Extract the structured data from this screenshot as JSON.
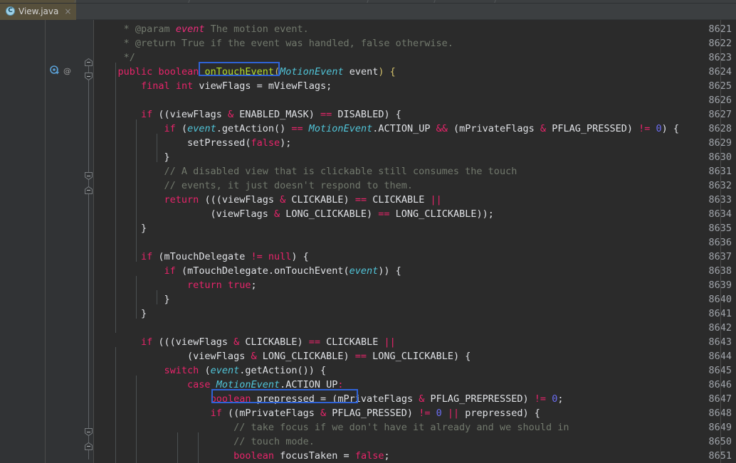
{
  "window": {
    "app": "java-code-editor",
    "theme_bg": "#2b2b2b",
    "gutter_bg": "#313335",
    "accent_highlight": "#2f63d7",
    "tab_bg": "#57503c"
  },
  "tabbar": {
    "tabs": [
      {
        "label": "View.java",
        "icon": "java-class-icon",
        "icon_letter": "C",
        "close": "×",
        "active": true
      }
    ]
  },
  "editor": {
    "first_line": 8621,
    "gutter_icons": {
      "line": 8624,
      "override_icon": "overriding-method-icon",
      "annotation_icon": "annotation-at-icon",
      "annotation_glyph": "@"
    },
    "highlights": [
      {
        "line": 8624,
        "text": "onTouchEvent",
        "color": "#2f63d7"
      },
      {
        "line": 8646,
        "text": "MotionEvent.ACTION_UP:",
        "color": "#2f63d7"
      }
    ],
    "lines": [
      {
        "n": 8621,
        "tokens": [
          {
            "t": "     * ",
            "c": "doc"
          },
          {
            "t": "@param ",
            "c": "doc"
          },
          {
            "t": "event",
            "c": "param"
          },
          {
            "t": " The motion event.",
            "c": "doc"
          }
        ]
      },
      {
        "n": 8622,
        "tokens": [
          {
            "t": "     * ",
            "c": "doc"
          },
          {
            "t": "@return True if the event was handled, false otherwise.",
            "c": "doc"
          }
        ]
      },
      {
        "n": 8623,
        "tokens": [
          {
            "t": "     */",
            "c": "doc"
          }
        ]
      },
      {
        "n": 8624,
        "tokens": [
          {
            "t": "    ",
            "c": "plain"
          },
          {
            "t": "public",
            "c": "kw2"
          },
          {
            "t": " ",
            "c": "plain"
          },
          {
            "t": "boolean",
            "c": "kw2"
          },
          {
            "t": " ",
            "c": "plain"
          },
          {
            "t": "onTouchEvent",
            "c": "mth"
          },
          {
            "t": "(",
            "c": "brcy"
          },
          {
            "t": "MotionEvent",
            "c": "typ"
          },
          {
            "t": " event",
            "c": "plain"
          },
          {
            "t": ")",
            "c": "brcy"
          },
          {
            "t": " ",
            "c": "plain"
          },
          {
            "t": "{",
            "c": "brcy"
          }
        ]
      },
      {
        "n": 8625,
        "tokens": [
          {
            "t": "        ",
            "c": "plain"
          },
          {
            "t": "final",
            "c": "kw2"
          },
          {
            "t": " ",
            "c": "plain"
          },
          {
            "t": "int",
            "c": "kw2"
          },
          {
            "t": " viewFlags ",
            "c": "plain"
          },
          {
            "t": "=",
            "c": "plain"
          },
          {
            "t": " mViewFlags;",
            "c": "plain"
          }
        ]
      },
      {
        "n": 8626,
        "tokens": []
      },
      {
        "n": 8627,
        "tokens": [
          {
            "t": "        ",
            "c": "plain"
          },
          {
            "t": "if",
            "c": "kw2"
          },
          {
            "t": " ((viewFlags ",
            "c": "plain"
          },
          {
            "t": "&",
            "c": "op"
          },
          {
            "t": " ENABLED_MASK) ",
            "c": "plain"
          },
          {
            "t": "==",
            "c": "op"
          },
          {
            "t": " DISABLED) {",
            "c": "plain"
          }
        ]
      },
      {
        "n": 8628,
        "tokens": [
          {
            "t": "            ",
            "c": "plain"
          },
          {
            "t": "if",
            "c": "kw2"
          },
          {
            "t": " (",
            "c": "plain"
          },
          {
            "t": "event",
            "c": "fld"
          },
          {
            "t": ".getAction() ",
            "c": "plain"
          },
          {
            "t": "==",
            "c": "op"
          },
          {
            "t": " ",
            "c": "plain"
          },
          {
            "t": "MotionEvent",
            "c": "typ"
          },
          {
            "t": ".ACTION_UP ",
            "c": "plain"
          },
          {
            "t": "&&",
            "c": "op"
          },
          {
            "t": " (mPrivateFlags ",
            "c": "plain"
          },
          {
            "t": "&",
            "c": "op"
          },
          {
            "t": " PFLAG_PRESSED) ",
            "c": "plain"
          },
          {
            "t": "!=",
            "c": "op"
          },
          {
            "t": " ",
            "c": "plain"
          },
          {
            "t": "0",
            "c": "num"
          },
          {
            "t": ") {",
            "c": "plain"
          }
        ]
      },
      {
        "n": 8629,
        "tokens": [
          {
            "t": "                setPressed(",
            "c": "plain"
          },
          {
            "t": "false",
            "c": "kw2"
          },
          {
            "t": ");",
            "c": "plain"
          }
        ]
      },
      {
        "n": 8630,
        "tokens": [
          {
            "t": "            }",
            "c": "plain"
          }
        ]
      },
      {
        "n": 8631,
        "tokens": [
          {
            "t": "            // A disabled view that is clickable still consumes the touch",
            "c": "cmt"
          }
        ]
      },
      {
        "n": 8632,
        "tokens": [
          {
            "t": "            // events, it just doesn't respond to them.",
            "c": "cmt"
          }
        ]
      },
      {
        "n": 8633,
        "tokens": [
          {
            "t": "            ",
            "c": "plain"
          },
          {
            "t": "return",
            "c": "kw2"
          },
          {
            "t": " (((viewFlags ",
            "c": "plain"
          },
          {
            "t": "&",
            "c": "op"
          },
          {
            "t": " CLICKABLE) ",
            "c": "plain"
          },
          {
            "t": "==",
            "c": "op"
          },
          {
            "t": " CLICKABLE ",
            "c": "plain"
          },
          {
            "t": "||",
            "c": "op"
          }
        ]
      },
      {
        "n": 8634,
        "tokens": [
          {
            "t": "                    (viewFlags ",
            "c": "plain"
          },
          {
            "t": "&",
            "c": "op"
          },
          {
            "t": " LONG_CLICKABLE) ",
            "c": "plain"
          },
          {
            "t": "==",
            "c": "op"
          },
          {
            "t": " LONG_CLICKABLE));",
            "c": "plain"
          }
        ]
      },
      {
        "n": 8635,
        "tokens": [
          {
            "t": "        }",
            "c": "plain"
          }
        ]
      },
      {
        "n": 8636,
        "tokens": []
      },
      {
        "n": 8637,
        "tokens": [
          {
            "t": "        ",
            "c": "plain"
          },
          {
            "t": "if",
            "c": "kw2"
          },
          {
            "t": " (mTouchDelegate ",
            "c": "plain"
          },
          {
            "t": "!=",
            "c": "op"
          },
          {
            "t": " ",
            "c": "plain"
          },
          {
            "t": "null",
            "c": "kw2"
          },
          {
            "t": ") {",
            "c": "plain"
          }
        ]
      },
      {
        "n": 8638,
        "tokens": [
          {
            "t": "            ",
            "c": "plain"
          },
          {
            "t": "if",
            "c": "kw2"
          },
          {
            "t": " (mTouchDelegate.onTouchEvent(",
            "c": "plain"
          },
          {
            "t": "event",
            "c": "fld"
          },
          {
            "t": ")) {",
            "c": "plain"
          }
        ]
      },
      {
        "n": 8639,
        "tokens": [
          {
            "t": "                ",
            "c": "plain"
          },
          {
            "t": "return",
            "c": "kw2"
          },
          {
            "t": " ",
            "c": "plain"
          },
          {
            "t": "true",
            "c": "kw2"
          },
          {
            "t": ";",
            "c": "plain"
          }
        ]
      },
      {
        "n": 8640,
        "tokens": [
          {
            "t": "            }",
            "c": "plain"
          }
        ]
      },
      {
        "n": 8641,
        "tokens": [
          {
            "t": "        }",
            "c": "plain"
          }
        ]
      },
      {
        "n": 8642,
        "tokens": []
      },
      {
        "n": 8643,
        "tokens": [
          {
            "t": "        ",
            "c": "plain"
          },
          {
            "t": "if",
            "c": "kw2"
          },
          {
            "t": " (((viewFlags ",
            "c": "plain"
          },
          {
            "t": "&",
            "c": "op"
          },
          {
            "t": " CLICKABLE) ",
            "c": "plain"
          },
          {
            "t": "==",
            "c": "op"
          },
          {
            "t": " CLICKABLE ",
            "c": "plain"
          },
          {
            "t": "||",
            "c": "op"
          }
        ]
      },
      {
        "n": 8644,
        "tokens": [
          {
            "t": "                (viewFlags ",
            "c": "plain"
          },
          {
            "t": "&",
            "c": "op"
          },
          {
            "t": " LONG_CLICKABLE) ",
            "c": "plain"
          },
          {
            "t": "==",
            "c": "op"
          },
          {
            "t": " LONG_CLICKABLE) {",
            "c": "plain"
          }
        ]
      },
      {
        "n": 8645,
        "tokens": [
          {
            "t": "            ",
            "c": "plain"
          },
          {
            "t": "switch",
            "c": "kw2"
          },
          {
            "t": " (",
            "c": "plain"
          },
          {
            "t": "event",
            "c": "fld"
          },
          {
            "t": ".getAction()) {",
            "c": "plain"
          }
        ]
      },
      {
        "n": 8646,
        "tokens": [
          {
            "t": "                ",
            "c": "plain"
          },
          {
            "t": "case",
            "c": "kw2"
          },
          {
            "t": " ",
            "c": "plain"
          },
          {
            "t": "MotionEvent",
            "c": "typ"
          },
          {
            "t": ".ACTION_UP",
            "c": "plain"
          },
          {
            "t": ":",
            "c": "op"
          }
        ]
      },
      {
        "n": 8647,
        "tokens": [
          {
            "t": "                    ",
            "c": "plain"
          },
          {
            "t": "boolean",
            "c": "kw2"
          },
          {
            "t": " prepressed ",
            "c": "plain"
          },
          {
            "t": "=",
            "c": "plain"
          },
          {
            "t": " (mPrivateFlags ",
            "c": "plain"
          },
          {
            "t": "&",
            "c": "op"
          },
          {
            "t": " PFLAG_PREPRESSED) ",
            "c": "plain"
          },
          {
            "t": "!=",
            "c": "op"
          },
          {
            "t": " ",
            "c": "plain"
          },
          {
            "t": "0",
            "c": "num"
          },
          {
            "t": ";",
            "c": "plain"
          }
        ]
      },
      {
        "n": 8648,
        "tokens": [
          {
            "t": "                    ",
            "c": "plain"
          },
          {
            "t": "if",
            "c": "kw2"
          },
          {
            "t": " ((mPrivateFlags ",
            "c": "plain"
          },
          {
            "t": "&",
            "c": "op"
          },
          {
            "t": " PFLAG_PRESSED) ",
            "c": "plain"
          },
          {
            "t": "!=",
            "c": "op"
          },
          {
            "t": " ",
            "c": "plain"
          },
          {
            "t": "0",
            "c": "num"
          },
          {
            "t": " ",
            "c": "plain"
          },
          {
            "t": "||",
            "c": "op"
          },
          {
            "t": " prepressed) {",
            "c": "plain"
          }
        ]
      },
      {
        "n": 8649,
        "tokens": [
          {
            "t": "                        // take focus if we don't have it already and we should in",
            "c": "cmt"
          }
        ]
      },
      {
        "n": 8650,
        "tokens": [
          {
            "t": "                        // touch mode.",
            "c": "cmt"
          }
        ]
      },
      {
        "n": 8651,
        "tokens": [
          {
            "t": "                        ",
            "c": "plain"
          },
          {
            "t": "boolean",
            "c": "kw2"
          },
          {
            "t": " focusTaken ",
            "c": "plain"
          },
          {
            "t": "=",
            "c": "plain"
          },
          {
            "t": " ",
            "c": "plain"
          },
          {
            "t": "false",
            "c": "kw2"
          },
          {
            "t": ";",
            "c": "plain"
          }
        ]
      }
    ]
  }
}
